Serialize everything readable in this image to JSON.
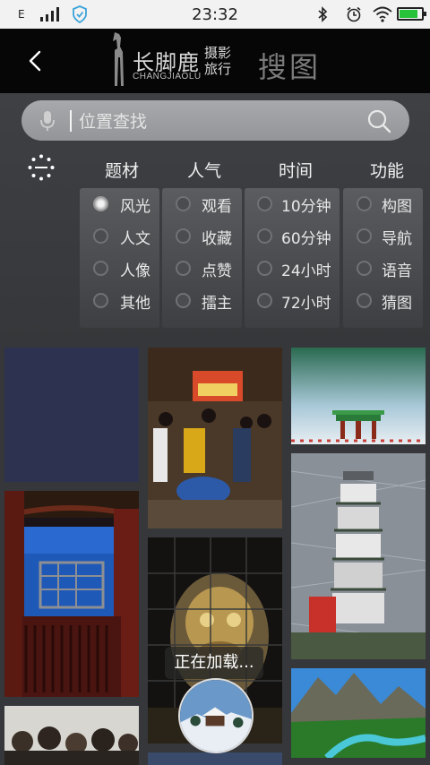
{
  "status_bar": {
    "network": "E",
    "time": "23:32",
    "icons": [
      "signal-icon",
      "shield-icon",
      "bluetooth-icon",
      "alarm-icon",
      "wifi-icon",
      "battery-icon"
    ],
    "battery_level": 0.85
  },
  "header": {
    "logo_text": "长脚鹿",
    "logo_en": "CHANGJIAOLU",
    "logo_sub": "摄影旅行",
    "title": "搜图"
  },
  "search": {
    "placeholder": "位置查找"
  },
  "filters": {
    "categories": [
      "题材",
      "人气",
      "时间",
      "功能"
    ],
    "subject": [
      "风光",
      "人文",
      "人像",
      "其他"
    ],
    "popularity": [
      "观看",
      "收藏",
      "点赞",
      "擂主"
    ],
    "time": [
      "10分钟",
      "60分钟",
      "24小时",
      "72小时"
    ],
    "function": [
      "构图",
      "导航",
      "语音",
      "猜图"
    ],
    "selected": "风光"
  },
  "loading_text": "正在加载...",
  "colors": {
    "header_bg": "#060606",
    "panel_bg": "#3e4044",
    "grid_bg": "#35373a",
    "battery": "#27c23a"
  }
}
